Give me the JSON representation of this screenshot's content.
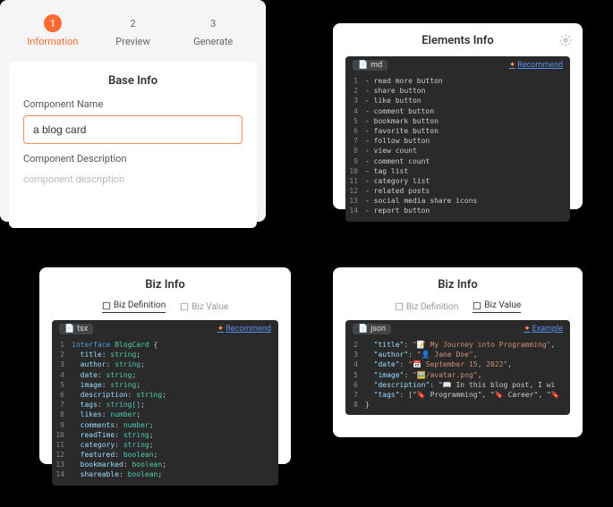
{
  "wizard": {
    "steps": [
      {
        "num": "1",
        "label": "Information",
        "active": true
      },
      {
        "num": "2",
        "label": "Preview",
        "active": false
      },
      {
        "num": "3",
        "label": "Generate",
        "active": false
      }
    ],
    "base": {
      "title": "Base Info",
      "name_label": "Component Name",
      "name_value": "a blog card",
      "desc_label": "Component Description",
      "desc_placeholder": "component description"
    }
  },
  "elements": {
    "title": "Elements Info",
    "file_type": "md",
    "link_label": "Recommend",
    "lines": [
      "- read more button",
      "- share button",
      "- like button",
      "- comment button",
      "- bookmark button",
      "- favorite button",
      "- follow button",
      "- view count",
      "- comment count",
      "- tag list",
      "- category list",
      "- related posts",
      "- social media share icons",
      "- report button"
    ]
  },
  "biz1": {
    "title": "Biz Info",
    "tabs": [
      {
        "label": "Biz Definition",
        "active": true
      },
      {
        "label": "Biz Value",
        "active": false
      }
    ],
    "file_type": "tsx",
    "link_label": "Recommend",
    "lines": [
      {
        "t": "interface BlogCard {",
        "cls": ""
      },
      {
        "t": "  title: string;",
        "cls": "kv"
      },
      {
        "t": "  author: string;",
        "cls": "kv"
      },
      {
        "t": "  date: string;",
        "cls": "kv"
      },
      {
        "t": "  image: string;",
        "cls": "kv"
      },
      {
        "t": "  description: string;",
        "cls": "kv"
      },
      {
        "t": "  tags: string[];",
        "cls": "kv"
      },
      {
        "t": "  likes: number;",
        "cls": "kv"
      },
      {
        "t": "  comments: number;",
        "cls": "kv"
      },
      {
        "t": "  readTime: string;",
        "cls": "kv"
      },
      {
        "t": "  category: string;",
        "cls": "kv"
      },
      {
        "t": "  featured: boolean;",
        "cls": "kv"
      },
      {
        "t": "  bookmarked: boolean;",
        "cls": "kv"
      },
      {
        "t": "  shareable: boolean;",
        "cls": "kv"
      }
    ]
  },
  "biz2": {
    "title": "Biz Info",
    "tabs": [
      {
        "label": "Biz Definition",
        "active": false
      },
      {
        "label": "Biz Value",
        "active": true
      }
    ],
    "file_type": "json",
    "link_label": "Example",
    "start": 2,
    "lines": [
      "  \"title\": \"📝 My Journey into Programming\",",
      "  \"author\": \"👤 Jane Doe\",",
      "  \"date\": \"📅 September 15, 2022\",",
      "  \"image\": \"🖼️/avatar.png\",",
      "  \"description\": \"📖 In this blog post, I wi",
      "  \"tags\": [\"🔖 Programming\", \"🔖 Career\", \"🔖",
      "}"
    ]
  }
}
